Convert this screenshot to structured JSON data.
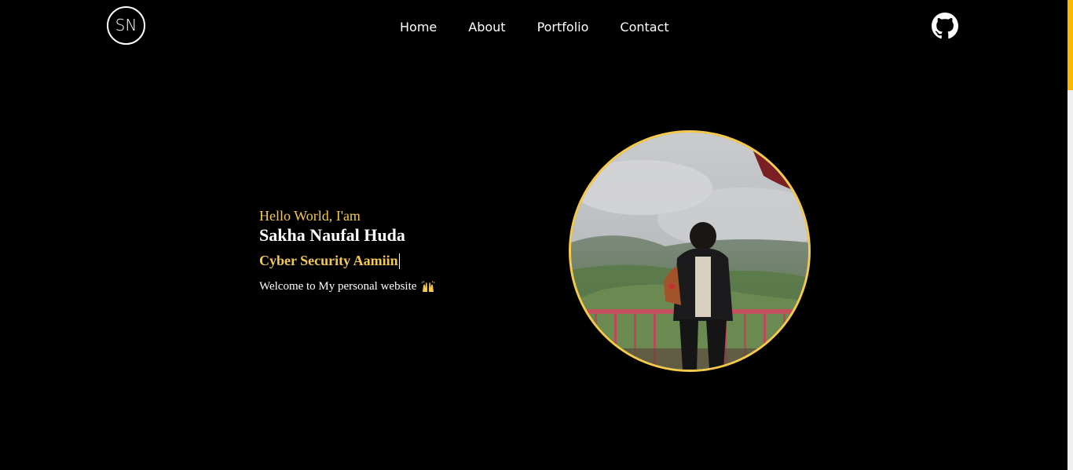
{
  "header": {
    "logo_text": "SN",
    "nav": [
      {
        "label": "Home"
      },
      {
        "label": "About"
      },
      {
        "label": "Portfolio"
      },
      {
        "label": "Contact"
      }
    ],
    "github_icon": "github-icon"
  },
  "hero": {
    "greeting": "Hello World, I'am",
    "name": "Sakha Naufal Huda",
    "role": "Cyber Security Aamiin",
    "welcome": "Welcome to My personal website",
    "welcome_emoji": "raising-hands-icon"
  },
  "colors": {
    "background": "#000000",
    "accent": "#f5c94a",
    "scroll_thumb": "#fcb900"
  }
}
